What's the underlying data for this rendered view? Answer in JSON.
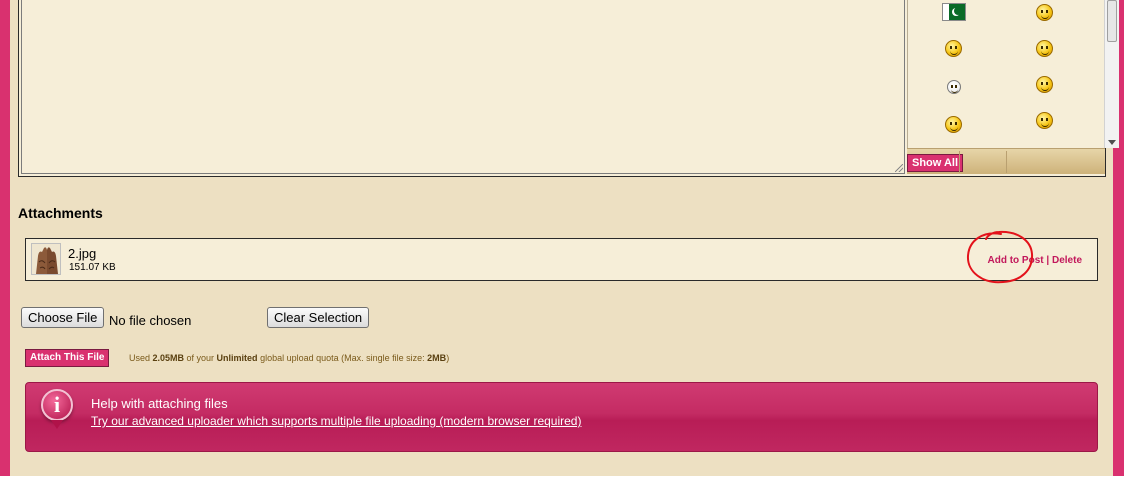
{
  "smilies": {
    "show_all_label": "Show All",
    "items": [
      {
        "icon": "pakistan-flag-icon"
      },
      {
        "icon": "skull-crossbones-smilie-icon"
      },
      {
        "icon": "thumbs-up-smilie-icon"
      },
      {
        "icon": "surprised-smilie-icon"
      },
      {
        "icon": "pale-smile-smilie-icon"
      },
      {
        "icon": "confused-smilie-icon"
      },
      {
        "icon": "hammer-smilie-icon"
      },
      {
        "icon": "worried-smilie-icon"
      }
    ]
  },
  "attachments": {
    "heading": "Attachments",
    "files": [
      {
        "name": "2.jpg",
        "size": "151.07 KB",
        "thumbnail_icon": "image-thumbnail-icon",
        "add_to_post_label": "Add to Post",
        "separator": "|",
        "delete_label": "Delete"
      }
    ],
    "choose_file_label": "Choose File",
    "no_file_text": "No file chosen",
    "clear_selection_label": "Clear Selection",
    "attach_button_label": "Attach This File",
    "quota": {
      "prefix": "Used ",
      "used": "2.05MB",
      "middle1": " of your ",
      "limit": "Unlimited",
      "middle2": " global upload quota (Max. single file size: ",
      "max": "2MB",
      "suffix": ")"
    }
  },
  "help": {
    "icon": "info-icon",
    "icon_glyph": "i",
    "title": "Help with attaching files",
    "link_text": "Try our advanced uploader which supports multiple file uploading (modern browser required)"
  },
  "colors": {
    "frame": "#d9316f",
    "page_background": "#ede0c2",
    "panel_background": "#f6eed8",
    "help_banner": "#c42b63",
    "annotation": "#e3121b"
  }
}
